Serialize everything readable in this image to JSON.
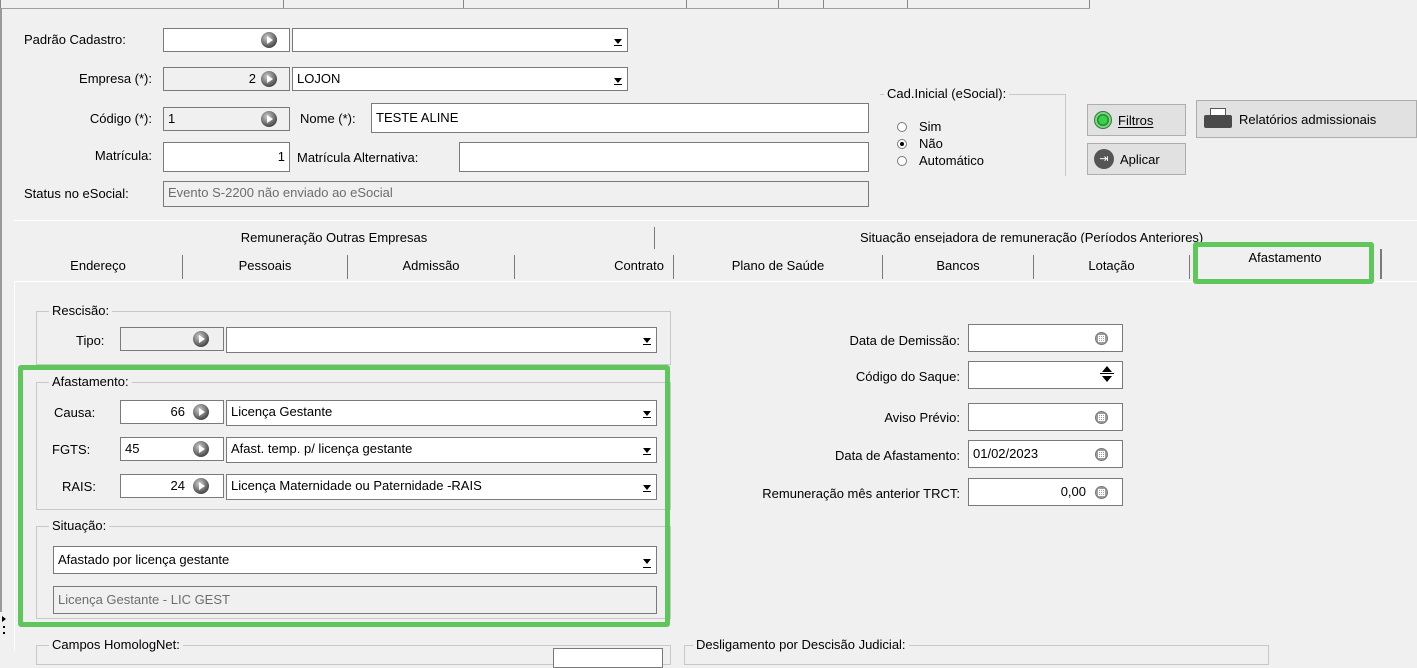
{
  "header": {
    "padrao_label": "Padrão Cadastro:",
    "padrao_value": "",
    "padrao_desc": "",
    "empresa_label": "Empresa (*):",
    "empresa_value": "2",
    "empresa_desc": "LOJON",
    "codigo_label": "Código (*):",
    "codigo_value": "1",
    "nome_label": "Nome (*):",
    "nome_value": "TESTE ALINE",
    "matricula_label": "Matrícula:",
    "matricula_value": "1",
    "matricula_alt_label": "Matrícula Alternativa:",
    "matricula_alt_value": "",
    "status_label": "Status no eSocial:",
    "status_value": "Evento S-2200 não enviado ao eSocial"
  },
  "cad_inicial": {
    "title": "Cad.Inicial (eSocial):",
    "options": [
      "Sim",
      "Não",
      "Automático"
    ],
    "selected": "Não"
  },
  "buttons": {
    "filtros": "Filtros",
    "aplicar": "Aplicar",
    "relatorios": "Relatórios admissionais"
  },
  "tabs_top": [
    "Remuneração Outras Empresas",
    "Situação ensejadora de remuneração (Períodos Anteriores)"
  ],
  "tabs_bottom": [
    "Endereço",
    "Pessoais",
    "Admissão",
    "Contrato",
    "Plano de Saúde",
    "Bancos",
    "Lotação",
    "Afastamento"
  ],
  "active_tab": "Afastamento",
  "rescisao": {
    "title": "Rescisão:",
    "tipo_label": "Tipo:",
    "tipo_value": "",
    "tipo_desc": ""
  },
  "afastamento": {
    "title": "Afastamento:",
    "causa_label": "Causa:",
    "causa_value": "66",
    "causa_desc": "Licença Gestante",
    "fgts_label": "FGTS:",
    "fgts_value": "45",
    "fgts_desc": "Afast. temp. p/ licença gestante",
    "rais_label": "RAIS:",
    "rais_value": "24",
    "rais_desc": "Licença Maternidade ou Paternidade -RAIS"
  },
  "situacao": {
    "title": "Situação:",
    "value": "Afastado por licença gestante",
    "desc": "Licença Gestante - LIC GEST"
  },
  "right_fields": {
    "data_demissao_label": "Data de Demissão:",
    "data_demissao_value": "",
    "codigo_saque_label": "Código do Saque:",
    "codigo_saque_value": "",
    "aviso_previo_label": "Aviso Prévio:",
    "aviso_previo_value": "",
    "data_afastamento_label": "Data de Afastamento:",
    "data_afastamento_value": "01/02/2023",
    "remuneracao_label": "Remuneração mês anterior TRCT:",
    "remuneracao_value": "0,00"
  },
  "bottom_groups": {
    "homolognet": "Campos HomologNet:",
    "desligamento": "Desligamento por Descisão Judicial:"
  },
  "colors": {
    "highlight": "#5ec65a",
    "background": "#f0f0f0"
  }
}
